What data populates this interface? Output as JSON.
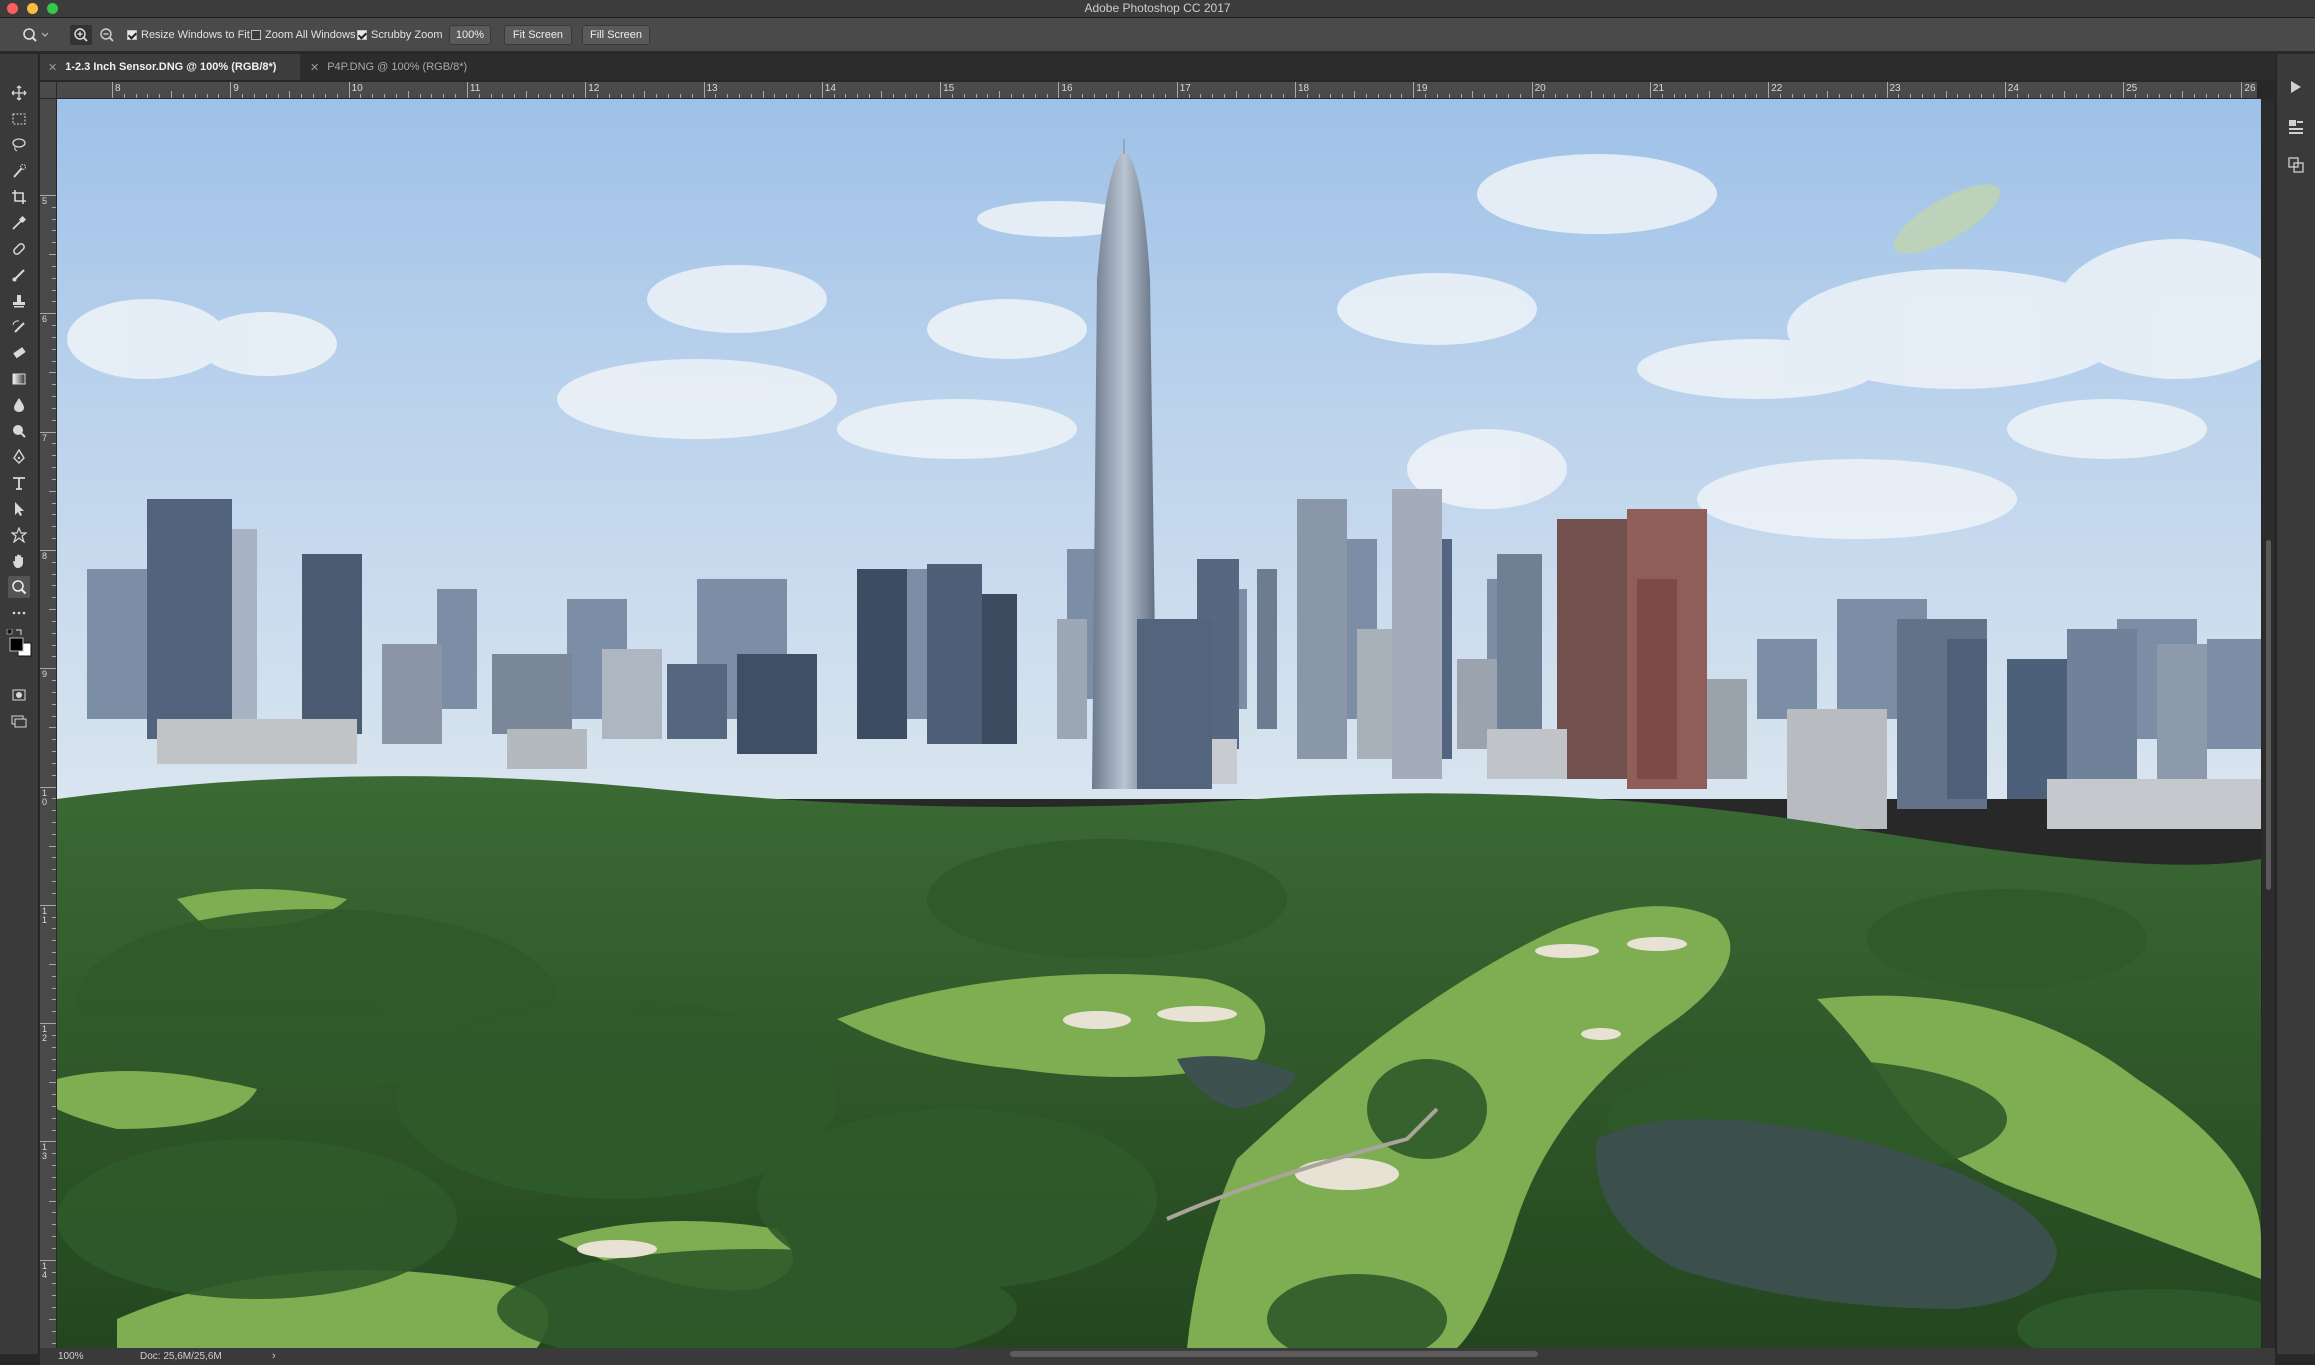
{
  "window": {
    "title": "Adobe Photoshop CC 2017"
  },
  "colors": {
    "close": "#fc605c",
    "minimize": "#fdbc40",
    "zoom": "#34c84a"
  },
  "options_bar": {
    "tool_icon": "zoom-tool-icon",
    "resize_windows": {
      "label": "Resize Windows to Fit",
      "checked": true
    },
    "zoom_all_windows": {
      "label": "Zoom All Windows",
      "checked": false
    },
    "scrubby_zoom": {
      "label": "Scrubby Zoom",
      "checked": true
    },
    "zoom_value": "100%",
    "fit_screen": "Fit Screen",
    "fill_screen": "Fill Screen"
  },
  "tabs": [
    {
      "label": "1-2.3 Inch Sensor.DNG @ 100% (RGB/8*)",
      "active": true
    },
    {
      "label": "P4P.DNG @ 100% (RGB/8*)",
      "active": false
    }
  ],
  "ruler": {
    "horizontal": [
      "8",
      "9",
      "10",
      "11",
      "12",
      "13",
      "14",
      "15",
      "16",
      "17",
      "18",
      "19",
      "20",
      "21",
      "22",
      "23",
      "24",
      "25",
      "26"
    ],
    "vertical": [
      "5",
      "6",
      "7",
      "8",
      "9",
      "1\n0",
      "1\n1",
      "1\n2",
      "1\n3",
      "1\n4"
    ]
  },
  "tools": [
    "move-tool-icon",
    "marquee-tool-icon",
    "lasso-tool-icon",
    "quick-select-tool-icon",
    "crop-tool-icon",
    "eyedropper-tool-icon",
    "healing-brush-icon",
    "brush-tool-icon",
    "clone-stamp-icon",
    "history-brush-icon",
    "eraser-tool-icon",
    "gradient-tool-icon",
    "blur-tool-icon",
    "dodge-tool-icon",
    "pen-tool-icon",
    "type-tool-icon",
    "path-select-icon",
    "shape-tool-icon",
    "hand-tool-icon",
    "zoom-tool-icon",
    "more-tools-icon"
  ],
  "status": {
    "zoom": "100%",
    "doc": "Doc: 25,6M/25,6M"
  }
}
